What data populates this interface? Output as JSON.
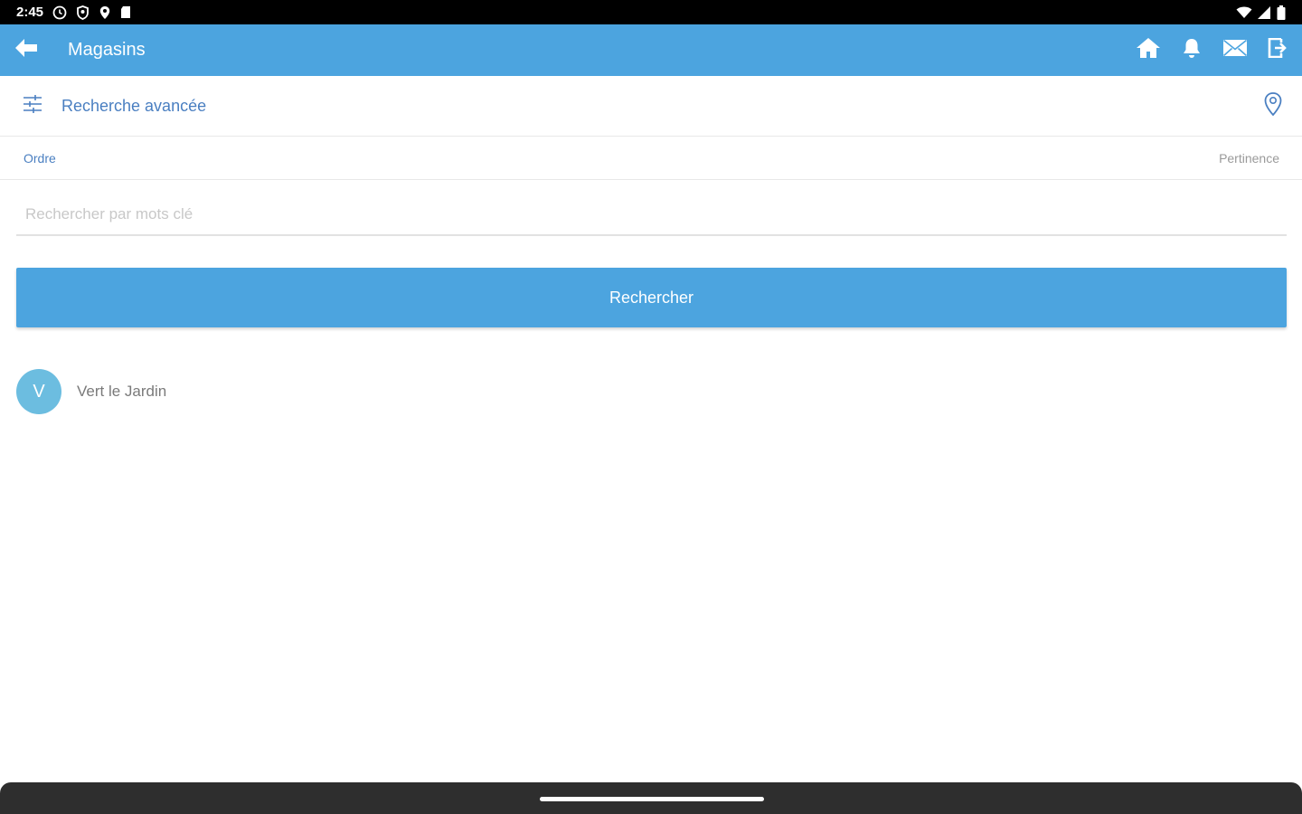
{
  "status_bar": {
    "time": "2:45"
  },
  "app_bar": {
    "title": "Magasins",
    "color": "#4ca4df",
    "icons": [
      "back-arrow-icon",
      "home-icon",
      "bell-icon",
      "mail-icon",
      "exit-icon"
    ]
  },
  "advanced_search": {
    "label": "Recherche avancée"
  },
  "order": {
    "label": "Ordre",
    "value": "Pertinence"
  },
  "search": {
    "placeholder": "Rechercher par mots clé",
    "value": "",
    "button_label": "Rechercher"
  },
  "stores": [
    {
      "initial": "V",
      "name": "Vert le Jardin"
    }
  ]
}
